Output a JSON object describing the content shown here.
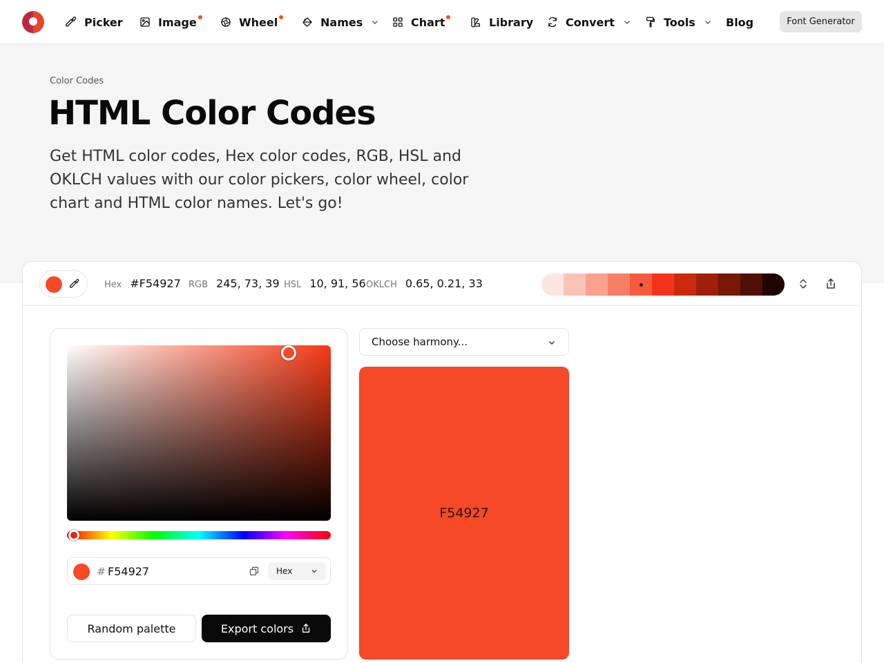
{
  "nav": {
    "items": [
      {
        "label": "Picker",
        "icon": "eyedropper-icon",
        "dot": false,
        "dropdown": false
      },
      {
        "label": "Image",
        "icon": "image-icon",
        "dot": true,
        "dropdown": false
      },
      {
        "label": "Wheel",
        "icon": "aperture-icon",
        "dot": true,
        "dropdown": false
      },
      {
        "label": "Names",
        "icon": "paint-bucket-icon",
        "dot": false,
        "dropdown": true
      },
      {
        "label": "Chart",
        "icon": "grid-icon",
        "dot": true,
        "dropdown": false
      },
      {
        "label": "Library",
        "icon": "swatchbook-icon",
        "dot": false,
        "dropdown": false
      },
      {
        "label": "Convert",
        "icon": "refresh-icon",
        "dot": false,
        "dropdown": true
      },
      {
        "label": "Tools",
        "icon": "paint-roller-icon",
        "dot": false,
        "dropdown": true
      },
      {
        "label": "Blog",
        "icon": "",
        "dot": false,
        "dropdown": false
      }
    ],
    "cta": "Font Generator",
    "accent": "#f25022"
  },
  "hero": {
    "breadcrumb": "Color Codes",
    "title": "HTML Color Codes",
    "intro": "Get HTML color codes, Hex color codes, RGB, HSL and OKLCH values with our color pickers, color wheel, color chart and HTML color names. Let's go!"
  },
  "toolbar": {
    "hex_label": "Hex",
    "hex_value": "#F54927",
    "rgb_label": "RGB",
    "rgb_value": "245, 73, 39",
    "hsl_label": "HSL",
    "hsl_value": "10, 91, 56",
    "oklch_label": "OKLCH",
    "oklch_value": "0.65, 0.21, 33",
    "shades": [
      "#fde6e2",
      "#fbc3b8",
      "#f9a08f",
      "#f77e66",
      "#f55b3d",
      "#f4331a",
      "#cc2a0f",
      "#9e200b",
      "#761708",
      "#4f0f05",
      "#1f0401"
    ],
    "current_shade_index": 4
  },
  "picker": {
    "selected_color": "#F54927",
    "hue": 10,
    "saturation": 91,
    "lightness": 56,
    "hash": "#",
    "hex_value": "F54927",
    "format": "Hex",
    "random_label": "Random palette",
    "export_label": "Export colors"
  },
  "harmony": {
    "placeholder": "Choose harmony...",
    "swatch_label": "F54927",
    "swatch_color": "#F54927"
  }
}
